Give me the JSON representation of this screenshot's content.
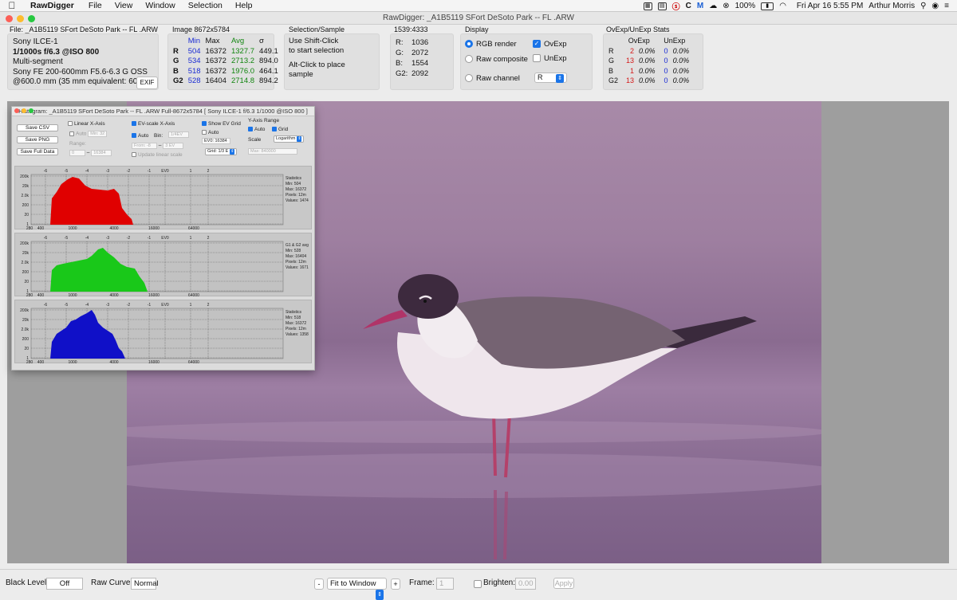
{
  "menubar": {
    "app_name": "RawDigger",
    "menus": [
      "File",
      "View",
      "Window",
      "Selection",
      "Help"
    ],
    "battery": "100%",
    "datetime": "Fri Apr 16  5:55 PM",
    "user": "Arthur Morris"
  },
  "window": {
    "title": "RawDigger: _A1B5119 SFort DeSoto Park -- FL .ARW"
  },
  "file_panel": {
    "title": "File: _A1B5119 SFort DeSoto Park -- FL .ARW",
    "camera": "Sony ILCE-1",
    "exposure": "1/1000s f/6.3 @ISO 800",
    "metering": "Multi-segment",
    "lens": "Sony FE 200-600mm F5.6-6.3 G OSS",
    "focal": "@600.0 mm (35 mm equivalent: 600.0",
    "exif_button": "EXIF"
  },
  "image_panel": {
    "title": "Image 8672x5784",
    "headers": [
      "Min",
      "Max",
      "Avg",
      "σ"
    ],
    "rows": [
      {
        "ch": "R",
        "min": "504",
        "max": "16372",
        "avg": "1327.7",
        "sd": "449.1"
      },
      {
        "ch": "G",
        "min": "534",
        "max": "16372",
        "avg": "2713.2",
        "sd": "894.0"
      },
      {
        "ch": "B",
        "min": "518",
        "max": "16372",
        "avg": "1976.0",
        "sd": "464.1"
      },
      {
        "ch": "G2",
        "min": "528",
        "max": "16404",
        "avg": "2714.8",
        "sd": "894.2"
      }
    ]
  },
  "selection_panel": {
    "title": "Selection/Sample",
    "line1": "Use Shift-Click",
    "line2": "to start selection",
    "line3": "Alt-Click to place",
    "line4": "sample"
  },
  "pixel_panel": {
    "title": "1539:4333",
    "rows": [
      {
        "label": "R:",
        "value": "1036"
      },
      {
        "label": "G:",
        "value": "2072"
      },
      {
        "label": "B:",
        "value": "1554"
      },
      {
        "label": "G2:",
        "value": "2092"
      }
    ]
  },
  "display_panel": {
    "title": "Display",
    "rgb_render": "RGB render",
    "raw_composite": "Raw composite",
    "raw_channel": "Raw channel",
    "ovexp": "OvExp",
    "unexp": "UnExp",
    "channel_value": "R"
  },
  "ovexp_panel": {
    "title": "OvExp/UnExp Stats",
    "headers": [
      "OvExp",
      "UnExp"
    ],
    "rows": [
      {
        "ch": "R",
        "ov": "2",
        "ovp": "0.0%",
        "un": "0",
        "unp": "0.0%"
      },
      {
        "ch": "G",
        "ov": "13",
        "ovp": "0.0%",
        "un": "0",
        "unp": "0.0%"
      },
      {
        "ch": "B",
        "ov": "1",
        "ovp": "0.0%",
        "un": "0",
        "unp": "0.0%"
      },
      {
        "ch": "G2",
        "ov": "13",
        "ovp": "0.0%",
        "un": "0",
        "unp": "0.0%"
      }
    ]
  },
  "histogram": {
    "title": "Histogram: _A1B5119 SFort DeSoto Park -- FL .ARW Full-8672x5784 [ Sony ILCE-1 f/6.3 1/1000 @ISO 800 ]",
    "save_csv": "Save CSV",
    "save_png": "Save PNG",
    "save_full": "Save Full Data",
    "linear_x": "Linear X-Axis",
    "auto": "Auto",
    "min_32": "Min: 32",
    "range": "Range:",
    "range_from": "0",
    "range_to": "16384",
    "ev_scale": "EV-scale X-Axis",
    "bin": "Bin:",
    "bin_value": "1/4EV",
    "from_label": "From: -8",
    "to_label": "3 EV",
    "update_linear": "Update linear scale",
    "show_ev_grid": "Show EV Grid",
    "ev0_value": "EV0: 16384",
    "grid_value": "Grid: 1/3 E",
    "y_axis_range": "Y-Axis Range",
    "grid": "Grid",
    "scale": "Scale",
    "scale_value": "Logarithm",
    "max_value": "Max: 840000",
    "ev_ticks": [
      "-6",
      "-5",
      "-4",
      "-3",
      "-2",
      "-1",
      "EV0",
      "1",
      "2"
    ],
    "x_ticks": [
      "280",
      "400",
      "1000",
      "4000",
      "16000",
      "64000"
    ],
    "y_ticks": [
      "200k",
      "20k",
      "2.0k",
      "200",
      "20",
      "1"
    ],
    "panels": [
      {
        "color": "#e00000",
        "stat_title": "Statistics",
        "min": "Min: 504",
        "max": "Max: 16372",
        "pixels": "Pixels: 12m",
        "values": "Values: 1474"
      },
      {
        "color": "#19c819",
        "stat_title": "G1 & G2 avg",
        "min": "Min: 528",
        "max": "Max: 16404",
        "pixels": "Pixels: 12m",
        "values": "Values: 1671"
      },
      {
        "color": "#1010c8",
        "stat_title": "Statistics",
        "min": "Min: 518",
        "max": "Max: 16372",
        "pixels": "Pixels: 12m",
        "values": "Values: 1358"
      }
    ]
  },
  "bottom": {
    "black_level_label": "Black Level:",
    "black_level_value": "Off",
    "raw_curve_label": "Raw Curve:",
    "raw_curve_value": "Normal",
    "zoom_minus": "-",
    "fit_value": "Fit to Window",
    "zoom_plus": "+",
    "frame_label": "Frame:",
    "frame_value": "1",
    "brighten_label": "Brighten:",
    "brighten_value": "0.00",
    "apply": "Apply"
  }
}
